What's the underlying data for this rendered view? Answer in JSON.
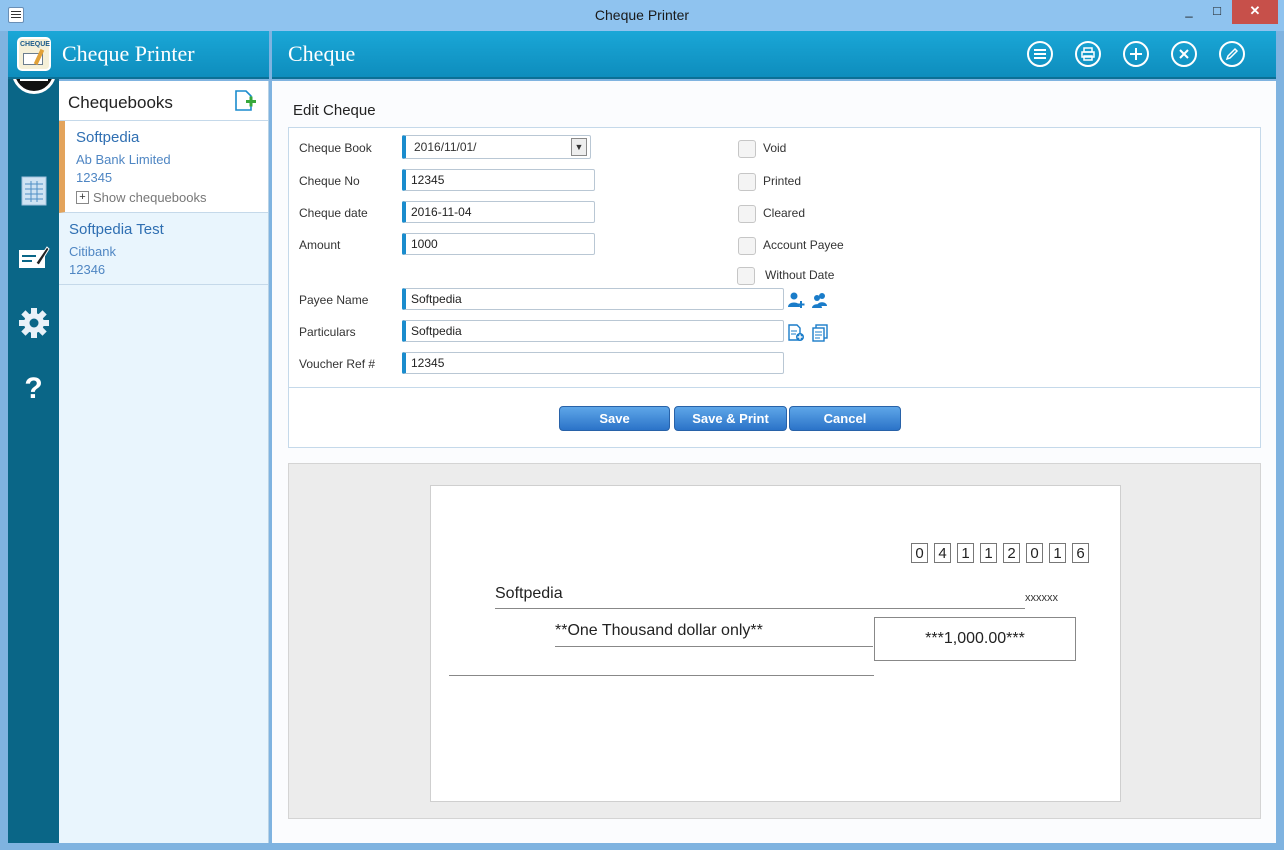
{
  "window": {
    "title": "Cheque Printer",
    "minimize": "_",
    "maximize": "□",
    "close": "✕"
  },
  "brand": {
    "title": "Cheque Printer",
    "logo_text": "CHEQUE"
  },
  "rail": {
    "items": [
      "cheques-icon",
      "report-icon",
      "edit-cheque-icon",
      "settings-icon",
      "help-icon"
    ],
    "help_glyph": "?"
  },
  "header": {
    "title": "Cheque",
    "icons": [
      "menu-icon",
      "print-icon",
      "add-icon",
      "delete-icon",
      "edit-icon"
    ]
  },
  "chequebooks": {
    "title": "Chequebooks",
    "items": [
      {
        "name": "Softpedia",
        "bank": "Ab Bank Limited",
        "number": "12345",
        "show_label": "Show chequebooks"
      },
      {
        "name": "Softpedia Test",
        "bank": "Citibank",
        "number": "12346"
      }
    ]
  },
  "form": {
    "section_title": "Edit Cheque",
    "fields": {
      "cheque_book": {
        "label": "Cheque Book",
        "value": "2016/11/01/"
      },
      "cheque_no": {
        "label": "Cheque No",
        "value": "12345"
      },
      "cheque_date": {
        "label": "Cheque date",
        "value": "2016-11-04"
      },
      "amount": {
        "label": "Amount",
        "value": "1000"
      },
      "payee_name": {
        "label": "Payee Name",
        "value": "Softpedia"
      },
      "particulars": {
        "label": "Particulars",
        "value": "Softpedia"
      },
      "voucher_ref": {
        "label": "Voucher Ref #",
        "value": "12345"
      }
    },
    "checkboxes": [
      {
        "label": "Void",
        "checked": false
      },
      {
        "label": "Printed",
        "checked": false
      },
      {
        "label": "Cleared",
        "checked": false
      },
      {
        "label": "Account Payee",
        "checked": false
      },
      {
        "label": "Without Date",
        "checked": false
      }
    ],
    "buttons": {
      "save": "Save",
      "save_print": "Save & Print",
      "cancel": "Cancel"
    }
  },
  "preview": {
    "date_digits": [
      "0",
      "4",
      "1",
      "1",
      "2",
      "0",
      "1",
      "6"
    ],
    "payee": "Softpedia",
    "bearer_mark": "xxxxxx",
    "amount_words": "**One Thousand dollar only**",
    "amount_figures": "***1,000.00***"
  },
  "colors": {
    "accent": "#0e8dbd",
    "rail": "#0a6687",
    "button": "#2b73c8",
    "selected_marker": "#e3a35b",
    "link_text": "#2f6fb2"
  }
}
